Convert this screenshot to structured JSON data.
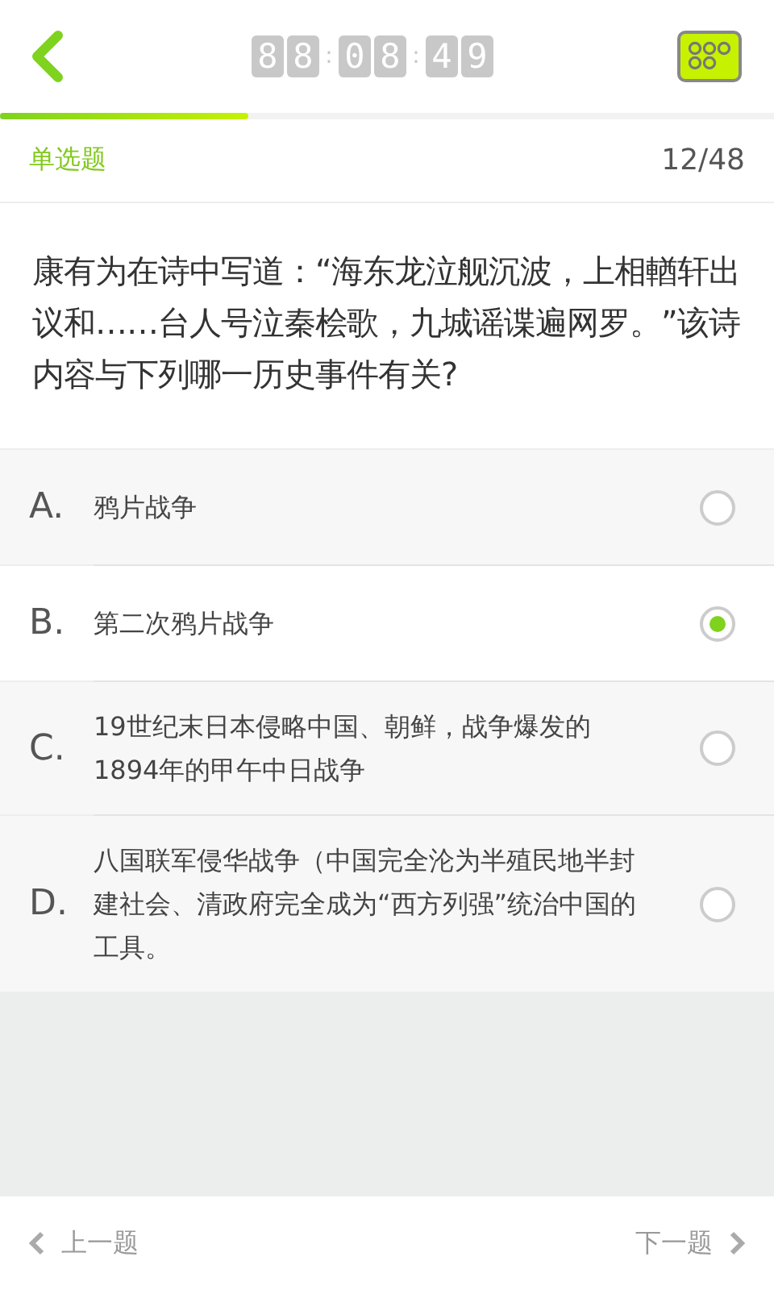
{
  "timer": [
    {
      "kind": "digit",
      "text": "8"
    },
    {
      "kind": "digit",
      "text": "8"
    },
    {
      "kind": "colon",
      "text": ":"
    },
    {
      "kind": "digit",
      "text": "0"
    },
    {
      "kind": "digit",
      "text": "8"
    },
    {
      "kind": "colon",
      "text": ":"
    },
    {
      "kind": "digit",
      "text": "4"
    },
    {
      "kind": "digit",
      "text": "9"
    }
  ],
  "progress": {
    "level": 0.32
  },
  "question_type": "单选题",
  "counter": "12/48",
  "question": "康有为在诗中写道：“海东龙泣舰沉波，上相輶轩出议和……台人号泣秦桧歌，九城谣谍遍网罗。”该诗内容与下列哪一历史事件有关?",
  "options": [
    {
      "letter": "A.",
      "text": "鸦片战争",
      "selected": false
    },
    {
      "letter": "B.",
      "text": "第二次鸦片战争",
      "selected": true
    },
    {
      "letter": "C.",
      "text": "19世纪末日本侵略中国、朝鲜，战争爆发的1894年的甲午中日战争",
      "selected": false
    },
    {
      "letter": "D.",
      "text": "八国联军侵华战争（中国完全沦为半殖民地半封建社会、清政府完全成为“西方列强”统治中国的工具。",
      "selected": false
    }
  ],
  "footer": {
    "prev": "上一题",
    "next": "下一题"
  }
}
